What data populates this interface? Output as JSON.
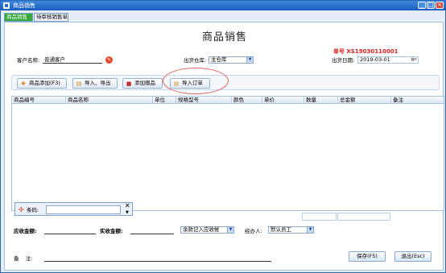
{
  "window": {
    "title": "商品销售",
    "min": "_",
    "max": "□",
    "close": "×"
  },
  "tabs": [
    {
      "label": "商品销售"
    },
    {
      "label": "待审核销售单"
    }
  ],
  "heading": "商品销售",
  "order_no": "单号  XS19030110001",
  "form": {
    "customer_label": "客户名称:",
    "customer_value": "普通客户",
    "warehouse_label": "出货仓库:",
    "warehouse_value": "主仓库",
    "date_label": "出货日期:",
    "date_value": "2019-03-01"
  },
  "toolbar": {
    "add_product": "商品添加(F3)",
    "import_export": "导入、导出",
    "add_gift": "添加赠品",
    "import_order": "导入订单"
  },
  "grid": {
    "columns": [
      "商品编号",
      "商品名称",
      "单位",
      "规格型号",
      "颜色",
      "单价",
      "数量",
      "总金额",
      "备注"
    ]
  },
  "scan": {
    "label": "条码:",
    "value": ""
  },
  "footer": {
    "receivable_label": "应收金额:",
    "received_label": "实收金额:",
    "arrears_option": "余款记入应收帐",
    "handler_label": "经办人:",
    "handler_value": "默认员工",
    "remark_label": "备    注:",
    "save": "保存(F5)",
    "exit": "退出(Esc)"
  },
  "colors": {
    "accent": "#2a68b8",
    "tab_active": "#34a838",
    "order_no": "#e02020"
  }
}
